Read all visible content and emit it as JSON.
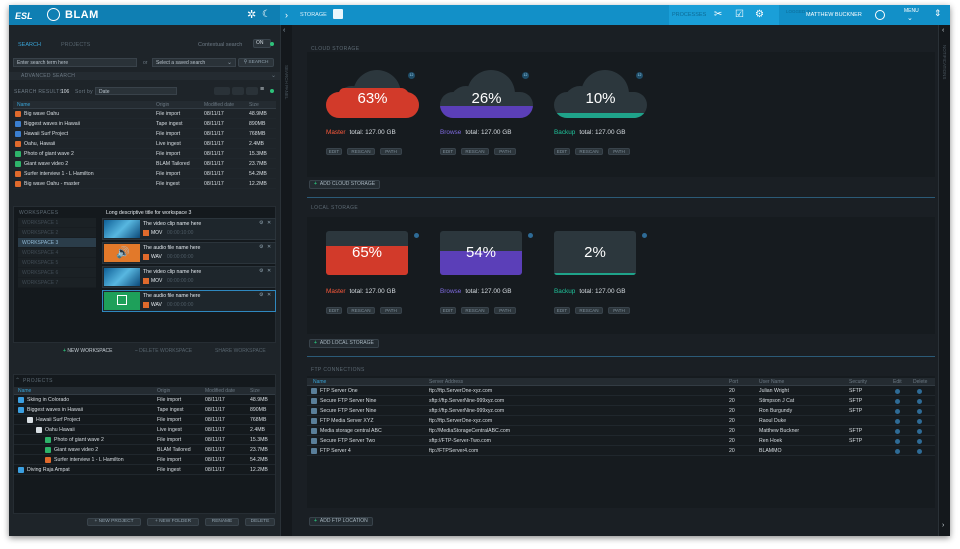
{
  "header": {
    "brand": "ESL",
    "app": "BLAM",
    "breadcrumb": "STORAGE",
    "processes": "PROCESSES",
    "user": "MATTHEW BUCKNER",
    "menu": "MENU",
    "logged_in": "LOGGED IN"
  },
  "search": {
    "tab_search": "SEARCH",
    "tab_projects": "PROJECTS",
    "contextual": "Contextual search",
    "toggle": "ON",
    "term_placeholder": "Enter search term here",
    "or": "or",
    "saved_placeholder": "Select a saved search",
    "search_btn": "SEARCH",
    "advanced": "ADVANCED SEARCH",
    "results_label": "SEARCH RESULTS",
    "results_count": "106",
    "sort_label": "Sort by",
    "sort_value": "Date"
  },
  "columns": {
    "name": "Name",
    "origin": "Origin",
    "modified": "Modified date",
    "size": "Size"
  },
  "results": [
    {
      "name": "Big wave Oahu",
      "origin": "File import",
      "date": "08/11/17",
      "size": "48.9MB",
      "color": "#e06a2c"
    },
    {
      "name": "Biggest waves in Hawaii",
      "origin": "Tape ingest",
      "date": "08/11/17",
      "size": "890MB",
      "color": "#3b7fd0"
    },
    {
      "name": "Hawaii Surf Project",
      "origin": "File import",
      "date": "08/11/17",
      "size": "768MB",
      "color": "#3b7fd0"
    },
    {
      "name": "Oahu, Hawaii",
      "origin": "Live ingest",
      "date": "08/11/17",
      "size": "2.4MB",
      "color": "#e06a2c"
    },
    {
      "name": "Photo of giant wave 2",
      "origin": "File import",
      "date": "08/11/17",
      "size": "15.3MB",
      "color": "#2eb36a"
    },
    {
      "name": "Giant wave video 2",
      "origin": "BLAM Tailored",
      "date": "08/11/17",
      "size": "23.7MB",
      "color": "#2eb36a"
    },
    {
      "name": "Surfer interview 1 - L Hamilton",
      "origin": "File import",
      "date": "08/11/17",
      "size": "54.2MB",
      "color": "#e06a2c"
    },
    {
      "name": "Big wave Oahu - master",
      "origin": "File ingest",
      "date": "08/11/17",
      "size": "12.2MB",
      "color": "#e06a2c"
    }
  ],
  "workspaces": {
    "title": "WORKSPACES",
    "desc": "Long descriptive title for workspace 3",
    "items": [
      "WORKSPACE 1",
      "WORKSPACE 2",
      "WORKSPACE 3",
      "WORKSPACE 4",
      "WORKSPACE 5",
      "WORKSPACE 6",
      "WORKSPACE 7"
    ],
    "cards": [
      {
        "title": "The video clip name here",
        "fmt": "MOV",
        "sub": "00:00:10:00"
      },
      {
        "title": "The audio file name here",
        "fmt": "WAV",
        "sub": "00:00:00:00"
      },
      {
        "title": "The video clip name here",
        "fmt": "MOV",
        "sub": "00:00:00:00"
      },
      {
        "title": "The audio file name here",
        "fmt": "WAV",
        "sub": "00:00:00:00"
      }
    ],
    "add": "NEW WORKSPACE",
    "delete": "DELETE WORKSPACE",
    "share": "SHARE WORKSPACE"
  },
  "projects": {
    "title": "PROJECTS",
    "rows": [
      {
        "name": "Skiing in Colorado",
        "origin": "File import",
        "date": "08/11/17",
        "size": "48.9MB",
        "indent": 0,
        "color": "#3b9fe0"
      },
      {
        "name": "Biggest waves in Hawaii",
        "origin": "Tape ingest",
        "date": "08/11/17",
        "size": "890MB",
        "indent": 0,
        "color": "#3b9fe0"
      },
      {
        "name": "Hawaii Surf Project",
        "origin": "File import",
        "date": "08/11/17",
        "size": "768MB",
        "indent": 1,
        "color": "#d8dee3"
      },
      {
        "name": "Oahu Hawaii",
        "origin": "Live ingest",
        "date": "08/11/17",
        "size": "2.4MB",
        "indent": 2,
        "color": "#d8dee3"
      },
      {
        "name": "Photo of giant wave 2",
        "origin": "File import",
        "date": "08/11/17",
        "size": "15.3MB",
        "indent": 3,
        "color": "#2eb36a"
      },
      {
        "name": "Giant wave video 2",
        "origin": "BLAM Tailored",
        "date": "08/11/17",
        "size": "23.7MB",
        "indent": 3,
        "color": "#2eb36a"
      },
      {
        "name": "Surfer interview 1 - L Hamilton",
        "origin": "File import",
        "date": "08/11/17",
        "size": "54.2MB",
        "indent": 3,
        "color": "#e06a2c"
      },
      {
        "name": "Diving Raja Ampat",
        "origin": "File ingest",
        "date": "08/11/17",
        "size": "12.2MB",
        "indent": 0,
        "color": "#3b9fe0"
      }
    ],
    "new_project": "NEW PROJECT",
    "new_folder": "NEW FOLDER",
    "rename": "RENAME",
    "delete": "DELETE"
  },
  "cloud": {
    "title": "CLOUD STORAGE",
    "add": "ADD CLOUD STORAGE",
    "items": [
      {
        "pct": "63%",
        "fill": 0.63,
        "kind": "Master",
        "total": "total: 127.00 GB",
        "color": "#d23a2a",
        "kcolor": "#ff5a3c",
        "badge": "12"
      },
      {
        "pct": "26%",
        "fill": 0.26,
        "kind": "Browse",
        "total": "total: 127.00 GB",
        "color": "#5b3fb8",
        "kcolor": "#7f6be0",
        "badge": "12"
      },
      {
        "pct": "10%",
        "fill": 0.1,
        "kind": "Backup",
        "total": "total: 127.00 GB",
        "color": "#1fa38a",
        "kcolor": "#20c29a",
        "badge": "12"
      }
    ]
  },
  "local": {
    "title": "LOCAL STORAGE",
    "add": "ADD LOCAL STORAGE",
    "items": [
      {
        "pct": "65%",
        "fill": 0.65,
        "kind": "Master",
        "total": "total: 127.00 GB",
        "color": "#d23a2a",
        "kcolor": "#ff5a3c"
      },
      {
        "pct": "54%",
        "fill": 0.54,
        "kind": "Browse",
        "total": "total: 127.00 GB",
        "color": "#5b3fb8",
        "kcolor": "#7f6be0"
      },
      {
        "pct": "2%",
        "fill": 0.02,
        "kind": "Backup",
        "total": "total: 127.00 GB",
        "color": "#1fa38a",
        "kcolor": "#20c29a"
      }
    ]
  },
  "storage_buttons": {
    "edit": "EDIT",
    "rescan": "RESCAN",
    "path": "PATH"
  },
  "ftp": {
    "title": "FTP CONNECTIONS",
    "add": "ADD FTP LOCATION",
    "cols": {
      "name": "Name",
      "address": "Server Address",
      "port": "Port",
      "user": "User Name",
      "security": "Security",
      "edit": "Edit",
      "delete": "Delete"
    },
    "rows": [
      {
        "name": "FTP Server One",
        "address": "ftp://ftp.ServerOne-xyz.com",
        "port": "20",
        "user": "Julian Wright",
        "sec": "SFTP"
      },
      {
        "name": "Secure FTP Server Nine",
        "address": "sftp://ftp.ServerNine-999xyz.com",
        "port": "20",
        "user": "Stimpson J Cat",
        "sec": "SFTP"
      },
      {
        "name": "Secure FTP Server Nine",
        "address": "sftp://ftp.ServerNine-999xyz.com",
        "port": "20",
        "user": "Ron Burgundy",
        "sec": "SFTP"
      },
      {
        "name": "FTP Media Server XYZ",
        "address": "ftp://ftp.ServerOne-xyz.com",
        "port": "20",
        "user": "Raoul Duke",
        "sec": ""
      },
      {
        "name": "Media storage central ABC",
        "address": "ftp://MediaStorageCentralABC.com",
        "port": "20",
        "user": "Matthew Buckner",
        "sec": "SFTP"
      },
      {
        "name": "Secure FTP Server Two",
        "address": "sftp://FTP-Server-Two.com",
        "port": "20",
        "user": "Ren Hoek",
        "sec": "SFTP"
      },
      {
        "name": "FTP Server 4",
        "address": "ftp://FTPServer4.com",
        "port": "20",
        "user": "BLAMMO",
        "sec": ""
      }
    ]
  },
  "sidebar": {
    "left": "SEARCH PANEL",
    "right": "NOTIFICATIONS"
  }
}
